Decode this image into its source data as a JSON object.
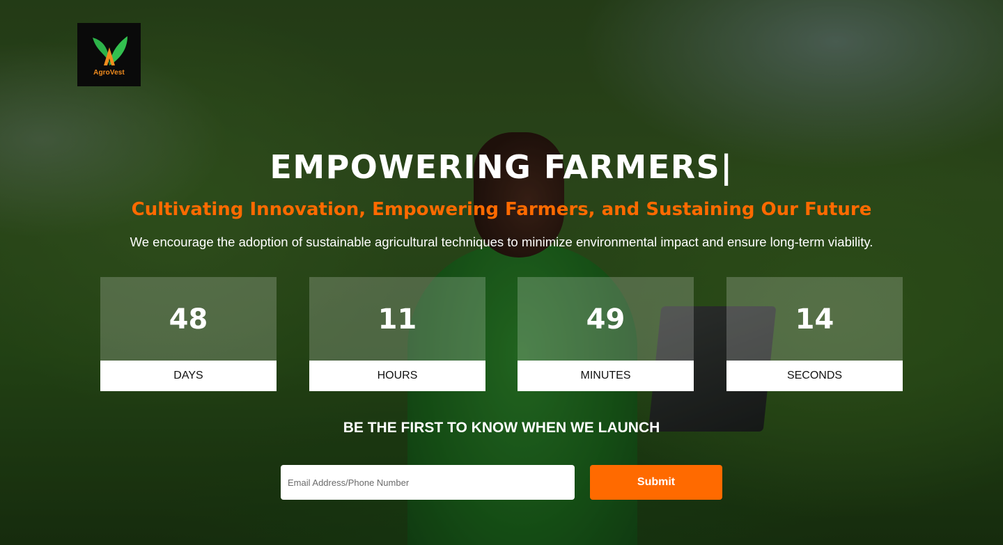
{
  "brand": {
    "name": "AgroVest",
    "colors": {
      "primary": "#ff6a00",
      "logo_leaf": "#2db34a"
    }
  },
  "hero": {
    "headline": "EMPOWERING FARMERS|",
    "tagline": "Cultivating Innovation, Empowering Farmers, and Sustaining Our Future",
    "description": "We encourage the adoption of sustainable agricultural techniques to minimize environmental impact and ensure long-term viability."
  },
  "countdown": [
    {
      "value": "48",
      "label": "DAYS"
    },
    {
      "value": "11",
      "label": "HOURS"
    },
    {
      "value": "49",
      "label": "MINUTES"
    },
    {
      "value": "14",
      "label": "SECONDS"
    }
  ],
  "signup": {
    "heading": "BE THE FIRST TO KNOW WHEN WE LAUNCH",
    "email_placeholder": "Email Address/Phone Number",
    "email_value": "",
    "submit_label": "Submit"
  }
}
